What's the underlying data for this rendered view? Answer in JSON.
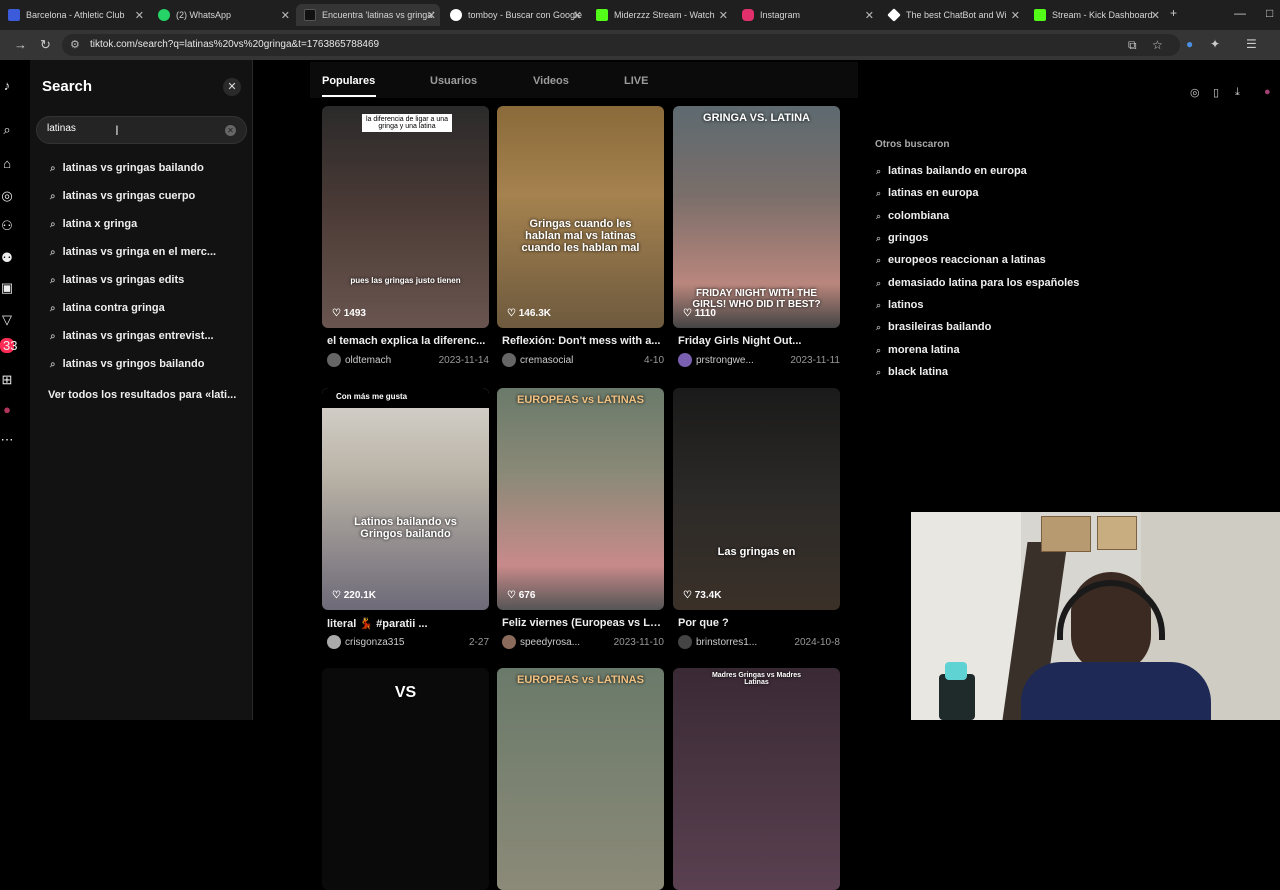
{
  "browser": {
    "tabs": [
      {
        "title": "Barcelona - Athletic Club",
        "color": "#3b5bdb"
      },
      {
        "title": "(2) WhatsApp",
        "color": "#25d366"
      },
      {
        "title": "Encuentra 'latinas vs gringa'",
        "color": "#111111"
      },
      {
        "title": "tomboy - Buscar con Google",
        "color": "#ffffff"
      },
      {
        "title": "Miderzzz Stream - Watch",
        "color": "#53fc18"
      },
      {
        "title": "Instagram",
        "color": "#e1306c"
      },
      {
        "title": "The best ChatBot and Wi",
        "color": "#ffffff"
      },
      {
        "title": "Stream - Kick Dashboard",
        "color": "#53fc18"
      }
    ],
    "url": "tiktok.com/search?q=latinas%20vs%20gringa&t=1763865788469"
  },
  "rail": {
    "badge_count": "33"
  },
  "search_panel": {
    "title": "Search",
    "query": "latinas",
    "suggestions": [
      "latinas vs gringas bailando",
      "latinas vs gringas cuerpo",
      "latina x gringa",
      "latinas vs gringa en el merc...",
      "latinas vs gringas edits",
      "latina contra gringa",
      "latinas vs gringas entrevist...",
      "latinas vs gringos bailando"
    ],
    "see_all": "Ver todos los resultados para «lati..."
  },
  "result_tabs": [
    "Populares",
    "Usuarios",
    "Videos",
    "LIVE"
  ],
  "videos": [
    {
      "likes": "1493",
      "overlay_top": "la diferencia de ligar a una gringa y una latina",
      "overlay_bottom": "pues las gringas justo tienen",
      "caption": "el temach explica la diferenc...",
      "user": "oldtemach",
      "date": "2023-11-14"
    },
    {
      "likes": "146.3K",
      "overlay_mid": "Gringas cuando les hablan mal vs latinas cuando les hablan mal",
      "caption": "Reflexión: Don't mess with a...",
      "user": "cremasocial",
      "date": "4-10"
    },
    {
      "likes": "1110",
      "overlay_top": "GRINGA VS. LATINA",
      "overlay_bottom": "FRIDAY NIGHT WITH THE GIRLS! WHO DID IT BEST?",
      "caption": "Friday Girls Night Out...",
      "user": "prstrongwe...",
      "date": "2023-11-11"
    },
    {
      "likes": "220.1K",
      "label": "Con más me gusta",
      "overlay_mid": "Latinos bailando vs Gringos bailando",
      "caption": "literal 💃 #paratii ...",
      "user": "crisgonza315",
      "date": "2-27"
    },
    {
      "likes": "676",
      "overlay_top": "EUROPEAS vs LATINAS",
      "caption": "Feliz viernes (Europeas vs La...",
      "user": "speedyrosa...",
      "date": "2023-11-10"
    },
    {
      "likes": "73.4K",
      "overlay_mid": "Las gringas en",
      "caption": "Por que ?",
      "user": "brinstorres1...",
      "date": "2024-10-8"
    },
    {
      "overlay_top": "VS"
    },
    {
      "overlay_top": "EUROPEAS vs LATINAS"
    },
    {
      "overlay_top": "Madres Gringas vs Madres Latinas"
    }
  ],
  "others": {
    "title": "Otros buscaron",
    "items": [
      "latinas bailando en europa",
      "latinas en europa",
      "colombiana",
      "gringos",
      "europeos reaccionan a latinas",
      "demasiado latina para los españoles",
      "latinos",
      "brasileiras bailando",
      "morena latina",
      "black latina"
    ]
  }
}
